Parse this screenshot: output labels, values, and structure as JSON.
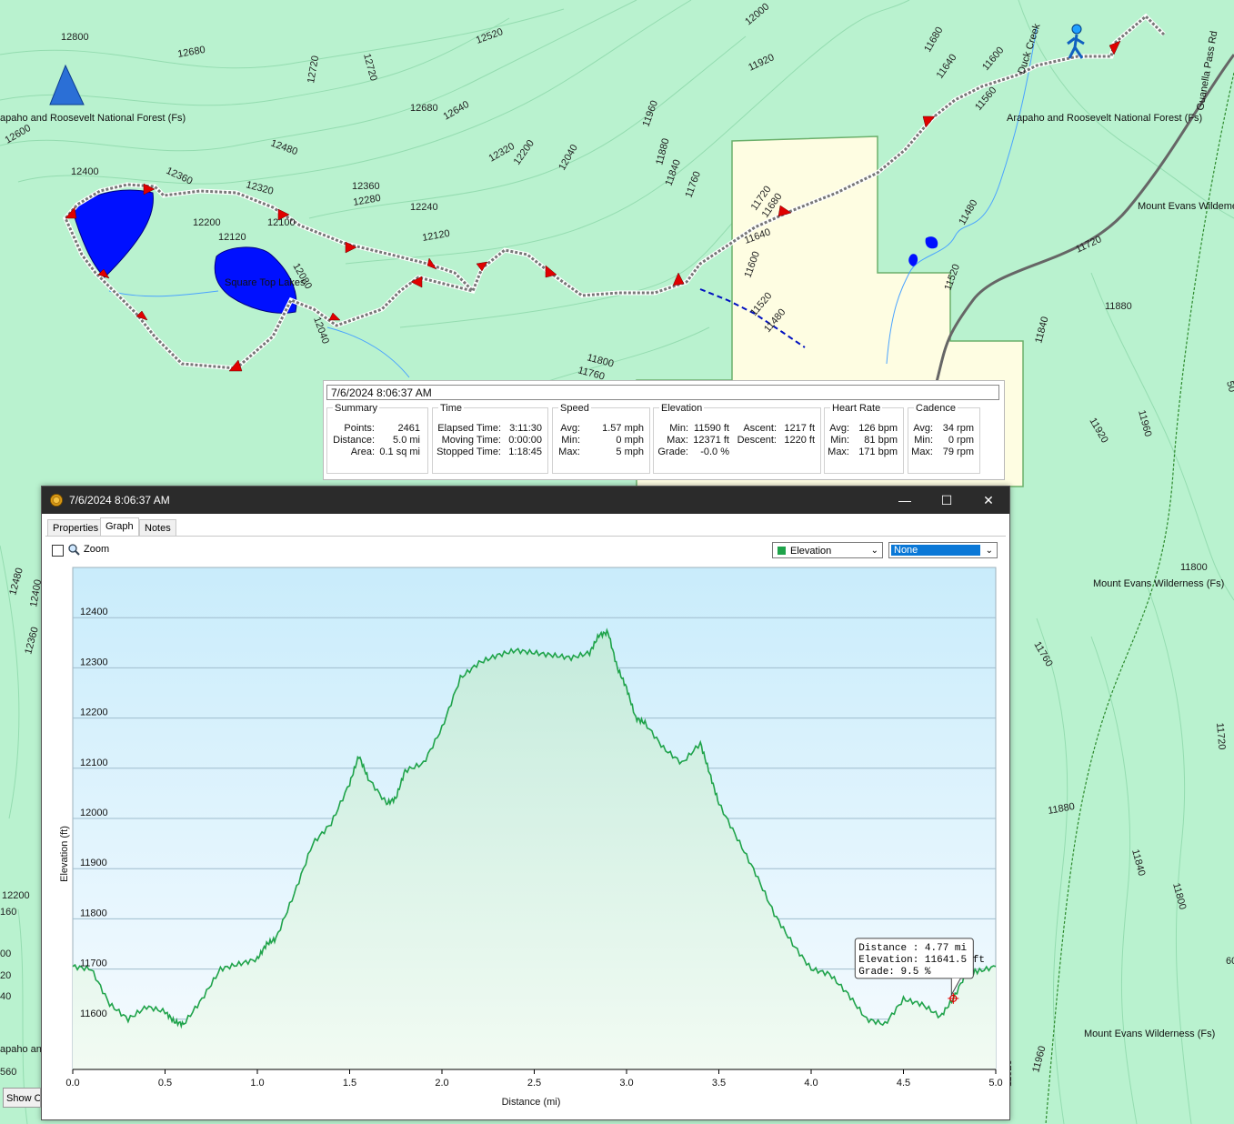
{
  "map": {
    "contour_labels": [
      "12800",
      "12680",
      "12720",
      "12720",
      "12520",
      "12000",
      "11920",
      "11680",
      "11640",
      "11600",
      "11560",
      "12600",
      "12480",
      "12680",
      "12640",
      "11960",
      "12400",
      "12360",
      "12320",
      "12360",
      "12280",
      "12240",
      "12320",
      "12200",
      "12040",
      "11880",
      "11840",
      "11760",
      "11720",
      "11680",
      "12200",
      "12100",
      "12120",
      "12120",
      "12080",
      "12040",
      "11640",
      "11600",
      "11520",
      "11480",
      "11480",
      "11720",
      "11520",
      "11880",
      "11840",
      "11800",
      "11760",
      "11920",
      "11960",
      "11800",
      "11760",
      "11720",
      "11880",
      "11840",
      "11800",
      "11960",
      "11920",
      "12480",
      "12400",
      "12360",
      "12200",
      "160",
      "00",
      "20",
      "40",
      "560",
      "50",
      "60"
    ],
    "place_labels": {
      "forest_left": "apaho and Roosevelt National Forest (Fs)",
      "forest_right": "Arapaho and Roosevelt National Forest (Fs)",
      "lakes": "Square Top Lakes",
      "duck_creek": "Duck Creek",
      "guanella": "Guanella Pass Rd",
      "evans_1": "Mount Evans Wildeme",
      "evans_2": "Mount Evans Wilderness (Fs)",
      "evans_3": "Mount Evans Wilderness (Fs)",
      "arapaho_bottom": "apaho an"
    }
  },
  "summary": {
    "timestamp": "7/6/2024 8:06:37 AM",
    "groups": [
      {
        "title": "Summary",
        "rows": [
          [
            "Points:",
            "2461"
          ],
          [
            "Distance:",
            "5.0 mi"
          ],
          [
            "Area:",
            "0.1 sq mi"
          ]
        ]
      },
      {
        "title": "Time",
        "rows": [
          [
            "Elapsed Time:",
            "3:11:30"
          ],
          [
            "Moving Time:",
            "0:00:00"
          ],
          [
            "Stopped Time:",
            "1:18:45"
          ]
        ]
      },
      {
        "title": "Speed",
        "rows": [
          [
            "Avg:",
            "1.57 mph"
          ],
          [
            "Min:",
            "0 mph"
          ],
          [
            "Max:",
            "5 mph"
          ]
        ]
      },
      {
        "title": "Elevation",
        "rows": [
          [
            "Min:",
            "11590 ft"
          ],
          [
            "Max:",
            "12371 ft"
          ],
          [
            "Grade:",
            "-0.0 %"
          ]
        ],
        "rows2": [
          [
            "Ascent:",
            "1217 ft"
          ],
          [
            "Descent:",
            "1220 ft"
          ]
        ]
      },
      {
        "title": "Heart Rate",
        "rows": [
          [
            "Avg:",
            "126 bpm"
          ],
          [
            "Min:",
            "81 bpm"
          ],
          [
            "Max:",
            "171 bpm"
          ]
        ]
      },
      {
        "title": "Cadence",
        "rows": [
          [
            "Avg:",
            "34 rpm"
          ],
          [
            "Min:",
            "0 rpm"
          ],
          [
            "Max:",
            "79 rpm"
          ]
        ]
      }
    ]
  },
  "window": {
    "title": "7/6/2024 8:06:37 AM",
    "minimize": "—",
    "maximize": "☐",
    "close": "✕",
    "tabs": [
      "Properties",
      "Graph",
      "Notes"
    ],
    "active_tab": "Graph",
    "zoom_label": "Zoom",
    "combo1": "Elevation",
    "combo2": "None"
  },
  "show_button": "Show O",
  "chart_data": {
    "type": "area",
    "xlabel": "Distance  (mi)",
    "ylabel": "Elevation (ft)",
    "xlim": [
      0,
      5.0
    ],
    "ylim": [
      11500,
      12500
    ],
    "xticks": [
      "0.0",
      "0.5",
      "1.0",
      "1.5",
      "2.0",
      "2.5",
      "3.0",
      "3.5",
      "4.0",
      "4.5",
      "5.0"
    ],
    "yticks": [
      "11600",
      "11700",
      "11800",
      "11900",
      "12000",
      "12100",
      "12200",
      "12300",
      "12400"
    ],
    "x": [
      0.0,
      0.1,
      0.2,
      0.3,
      0.4,
      0.5,
      0.55,
      0.6,
      0.7,
      0.8,
      0.9,
      1.0,
      1.05,
      1.1,
      1.2,
      1.3,
      1.4,
      1.5,
      1.55,
      1.6,
      1.7,
      1.75,
      1.8,
      1.9,
      2.0,
      2.1,
      2.2,
      2.3,
      2.4,
      2.5,
      2.6,
      2.7,
      2.8,
      2.85,
      2.9,
      2.95,
      3.0,
      3.05,
      3.1,
      3.2,
      3.3,
      3.4,
      3.45,
      3.5,
      3.6,
      3.7,
      3.8,
      3.9,
      4.0,
      4.1,
      4.2,
      4.3,
      4.4,
      4.5,
      4.6,
      4.7,
      4.77,
      4.85,
      4.9,
      5.0
    ],
    "y": [
      11705,
      11700,
      11630,
      11600,
      11625,
      11615,
      11595,
      11590,
      11640,
      11700,
      11710,
      11720,
      11750,
      11760,
      11850,
      11950,
      11990,
      12070,
      12125,
      12080,
      12030,
      12040,
      12095,
      12110,
      12180,
      12280,
      12310,
      12325,
      12335,
      12330,
      12325,
      12320,
      12330,
      12365,
      12371,
      12300,
      12260,
      12200,
      12190,
      12140,
      12110,
      12150,
      12090,
      12030,
      11960,
      11890,
      11810,
      11750,
      11700,
      11690,
      11650,
      11600,
      11590,
      11640,
      11630,
      11605,
      11641,
      11700,
      11695,
      11705
    ],
    "tooltip": {
      "distance": "Distance : 4.77 mi",
      "elevation": "Elevation: 11641.5 ft",
      "grade": "Grade: 9.5 %"
    },
    "cursor_x": 4.77,
    "cursor_y": 11641.5,
    "line_color": "#1fa34a",
    "grid": true
  }
}
